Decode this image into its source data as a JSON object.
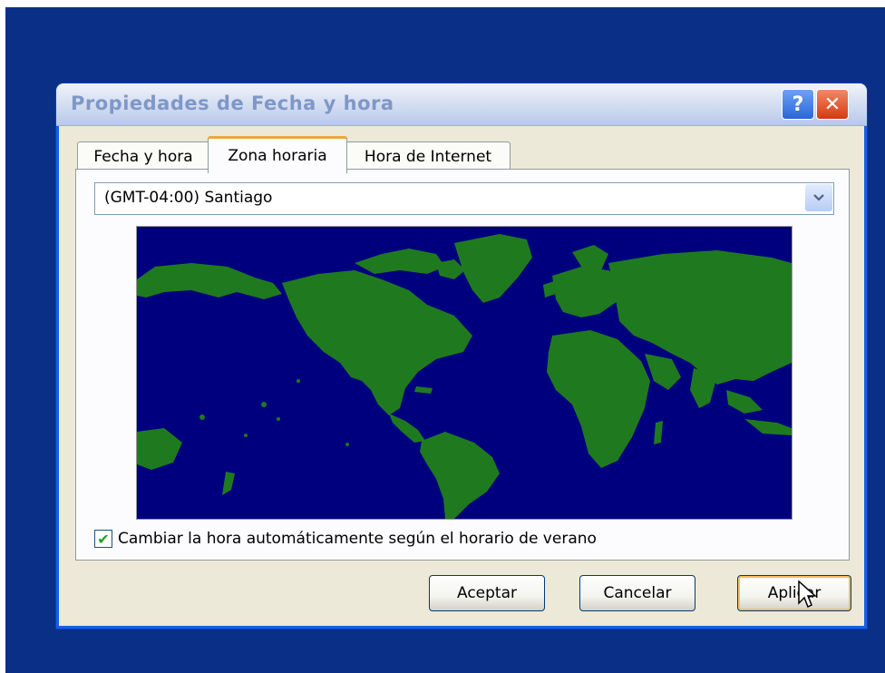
{
  "window": {
    "title": "Propiedades de Fecha y hora",
    "help_glyph": "?",
    "close_glyph": "✕"
  },
  "tabs": [
    {
      "label": "Fecha y hora",
      "active": false
    },
    {
      "label": "Zona horaria",
      "active": true
    },
    {
      "label": "Hora de Internet",
      "active": false
    }
  ],
  "timezone": {
    "selected": "(GMT-04:00) Santiago",
    "dropdown_icon": "chevron-down-icon"
  },
  "map": {
    "ocean_color": "#00007e",
    "land_color": "#1f7a1f"
  },
  "dst": {
    "label": "Cambiar la hora automáticamente según el horario de verano",
    "checked": true
  },
  "buttons": {
    "ok": "Aceptar",
    "cancel": "Cancelar",
    "apply": "Aplicar"
  },
  "colors": {
    "desktop": "#0a2f86",
    "window_bg": "#ece9d8",
    "tab_highlight": "#f0a43c"
  }
}
